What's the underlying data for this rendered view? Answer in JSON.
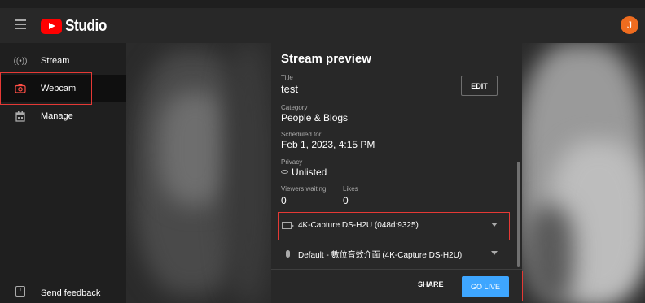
{
  "app": {
    "logo_text": "Studio",
    "avatar_initial": "J"
  },
  "sidebar": {
    "items": [
      {
        "label": "Stream",
        "icon": "broadcast-icon"
      },
      {
        "label": "Webcam",
        "icon": "camera-icon",
        "active": true
      },
      {
        "label": "Manage",
        "icon": "calendar-icon"
      }
    ],
    "feedback_label": "Send feedback"
  },
  "modal": {
    "title": "Stream preview",
    "title_label": "Title",
    "title_value": "test",
    "edit_label": "EDIT",
    "category_label": "Category",
    "category_value": "People & Blogs",
    "scheduled_label": "Scheduled for",
    "scheduled_value": "Feb 1, 2023, 4:15 PM",
    "privacy_label": "Privacy",
    "privacy_value": "Unlisted",
    "viewers_label": "Viewers waiting",
    "viewers_value": "0",
    "likes_label": "Likes",
    "likes_value": "0",
    "camera_value": "4K-Capture DS-H2U (048d:9325)",
    "mic_value": "Default - 數位音效介面 (4K-Capture DS-H2U)",
    "share_label": "SHARE",
    "golive_label": "GO LIVE"
  },
  "colors": {
    "accent": "#3ea6ff",
    "brand": "#ff0000",
    "highlight": "#e53935",
    "avatar": "#ef6c1f"
  }
}
